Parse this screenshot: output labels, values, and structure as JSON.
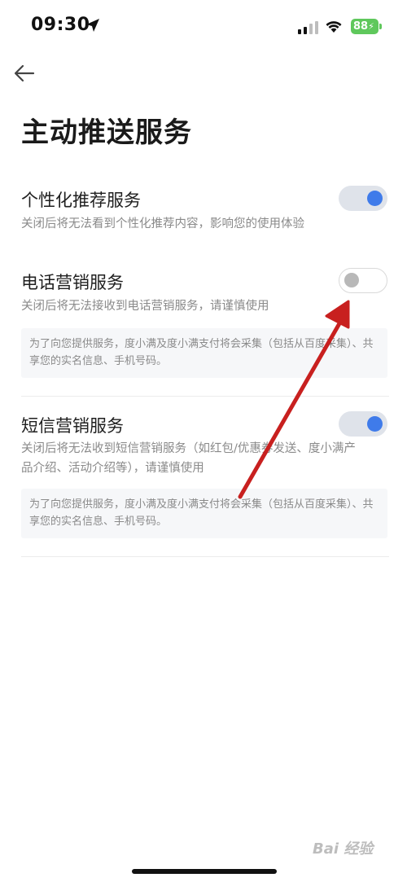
{
  "status": {
    "time": "09:30",
    "battery": "88"
  },
  "header": {
    "title": "主动推送服务"
  },
  "settings": [
    {
      "title": "个性化推荐服务",
      "desc": "关闭后将无法看到个性化推荐内容，影响您的使用体验",
      "enabled": true
    },
    {
      "title": "电话营销服务",
      "desc": "关闭后将无法接收到电话营销服务，请谨慎使用",
      "note": "为了向您提供服务，度小满及度小满支付将会采集（包括从百度采集）、共享您的实名信息、手机号码。",
      "enabled": false
    },
    {
      "title": "短信营销服务",
      "desc": "关闭后将无法收到短信营销服务（如红包/优惠券发送、度小满产品介绍、活动介绍等），请谨慎使用",
      "note": "为了向您提供服务，度小满及度小满支付将会采集（包括从百度采集）、共享您的实名信息、手机号码。",
      "enabled": true
    }
  ],
  "watermark": "Bai 经验",
  "colors": {
    "accent": "#3f7bea",
    "annotation": "#c8201f",
    "battery": "#5fc85c"
  }
}
